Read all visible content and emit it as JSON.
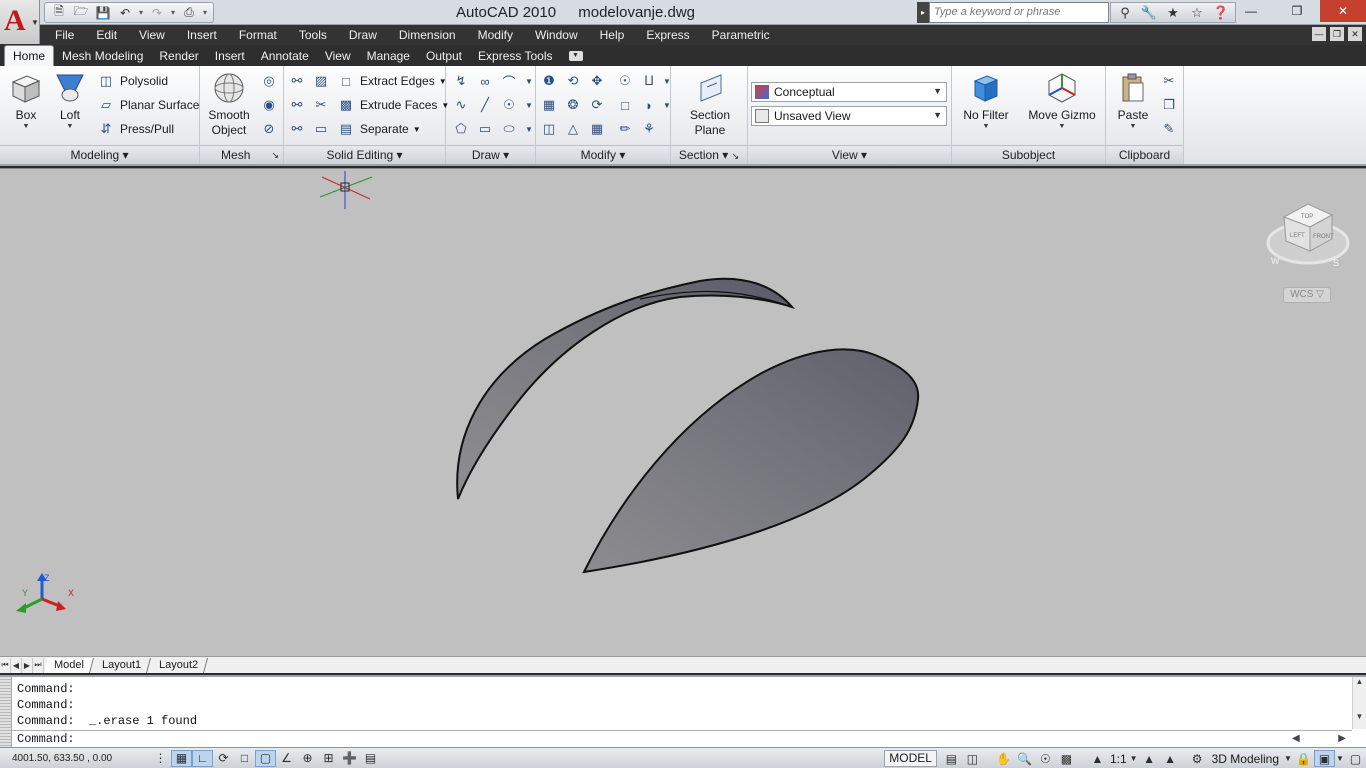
{
  "window": {
    "app_title": "AutoCAD 2010",
    "file_name": "modelovanje.dwg",
    "search_placeholder": "Type a keyword or phrase"
  },
  "menu": [
    "File",
    "Edit",
    "View",
    "Insert",
    "Format",
    "Tools",
    "Draw",
    "Dimension",
    "Modify",
    "Window",
    "Help",
    "Express",
    "Parametric"
  ],
  "ribbon_tabs": [
    "Home",
    "Mesh Modeling",
    "Render",
    "Insert",
    "Annotate",
    "View",
    "Manage",
    "Output",
    "Express Tools"
  ],
  "panels": {
    "modeling": {
      "title": "Modeling",
      "box": "Box",
      "loft": "Loft",
      "polysolid": "Polysolid",
      "planar_surface": "Planar Surface",
      "press_pull": "Press/Pull"
    },
    "mesh": {
      "title": "Mesh",
      "smooth_line1": "Smooth",
      "smooth_line2": "Object"
    },
    "solid_editing": {
      "title": "Solid Editing",
      "extract_edges": "Extract Edges",
      "extrude_faces": "Extrude Faces",
      "separate": "Separate"
    },
    "draw": {
      "title": "Draw"
    },
    "modify": {
      "title": "Modify"
    },
    "section": {
      "title": "Section",
      "plane_line1": "Section",
      "plane_line2": "Plane"
    },
    "view": {
      "title": "View",
      "visual_style": "Conceptual",
      "named_view": "Unsaved View"
    },
    "subobject": {
      "title": "Subobject",
      "no_filter": "No Filter",
      "move_gizmo": "Move Gizmo"
    },
    "clipboard": {
      "title": "Clipboard",
      "paste": "Paste"
    }
  },
  "viewcube": {
    "top": "TOP",
    "left": "LEFT",
    "front": "FRONT",
    "compass_w": "W",
    "compass_s": "S",
    "wcs": "WCS"
  },
  "ucs": {
    "x": "X",
    "y": "Y",
    "z": "Z"
  },
  "layout_tabs": [
    "Model",
    "Layout1",
    "Layout2"
  ],
  "command_line": {
    "history": [
      "Command:",
      "Command:",
      "Command:  _.erase 1 found"
    ],
    "prompt": "Command:"
  },
  "status": {
    "coordinates": "4001.50, 633.50 , 0.00",
    "space": "MODEL",
    "annotation_scale": "1:1",
    "workspace": "3D Modeling"
  },
  "colors": {
    "viewport_bg": "#c0c0c0",
    "surface_dark": "#60606c",
    "surface_light": "#8e8e92",
    "menu_bg": "#333333"
  }
}
